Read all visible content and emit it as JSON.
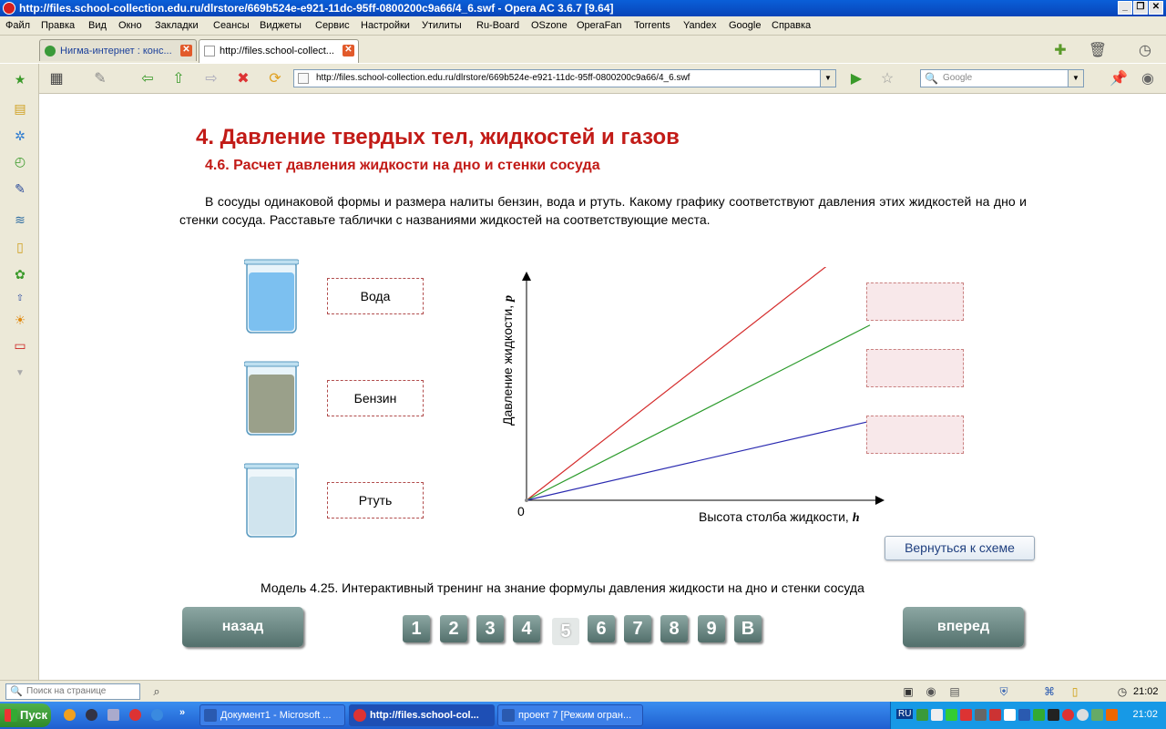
{
  "window": {
    "title": "http://files.school-collection.edu.ru/dlrstore/669b524e-e921-11dc-95ff-0800200c9a66/4_6.swf - Opera AC 3.6.7 [9.64]",
    "buttons": [
      "_",
      "❐",
      "✕"
    ]
  },
  "menu": [
    "Файл",
    "Правка",
    "Вид",
    "Окно",
    "Закладки",
    "Сеансы",
    "Виджеты",
    "Сервис",
    "Настройки",
    "Утилиты",
    "Ru-Board",
    "OSzone",
    "OperaFan",
    "Torrents",
    "Yandex",
    "Google",
    "Справка"
  ],
  "tabs": [
    {
      "label": "Нигма-интернет : конс...",
      "active": false
    },
    {
      "label": "http://files.school-collect...",
      "active": true
    }
  ],
  "address": {
    "url": "http://files.school-collection.edu.ru/dlrstore/669b524e-e921-11dc-95ff-0800200c9a66/4_6.swf",
    "search_placeholder": "Google"
  },
  "page": {
    "heading": "4. Давление твердых тел, жидкостей и газов",
    "subheading": "4.6. Расчет давления жидкости на дно и стенки сосуда",
    "task": "В сосуды одинаковой формы и размера налиты бензин, вода и ртуть. Какому графику соответствуют давления этих жидкостей на дно и стенки сосуда. Расставьте таблички с названиями жидкостей на соответствующие места.",
    "liquids": [
      {
        "label": "Вода",
        "color": "#7cc0f0"
      },
      {
        "label": "Бензин",
        "color": "#9aa08a"
      },
      {
        "label": "Ртуть",
        "color": "#d0e4ee"
      }
    ],
    "graph": {
      "ylabel": "Давление жидкости, ",
      "ylabel_var": "p",
      "xlabel": "Высота столба жидкости, ",
      "xlabel_var": "h",
      "origin": "0",
      "lines": [
        {
          "color": "#d42a2a",
          "slope": 0.78
        },
        {
          "color": "#2a9a2a",
          "slope": 0.51
        },
        {
          "color": "#2a2ab0",
          "slope": 0.23
        }
      ]
    },
    "back_to_scheme": "Вернуться к схеме",
    "caption": "Модель 4.25. Интерактивный тренинг на знание формулы давления жидкости на дно и стенки сосуда",
    "nav": {
      "back": "назад",
      "forward": "вперед",
      "pages": [
        "1",
        "2",
        "3",
        "4",
        "5",
        "6",
        "7",
        "8",
        "9",
        "В"
      ],
      "current": "5"
    }
  },
  "findbar": {
    "placeholder": "Поиск на странице",
    "clock": "21:02"
  },
  "taskbar": {
    "start": "Пуск",
    "tasks": [
      {
        "label": "Документ1 - Microsoft ...",
        "active": false
      },
      {
        "label": "http://files.school-col...",
        "active": true
      },
      {
        "label": "проект 7 [Режим огран...",
        "active": false
      }
    ],
    "lang": "RU",
    "clock": "21:02"
  }
}
